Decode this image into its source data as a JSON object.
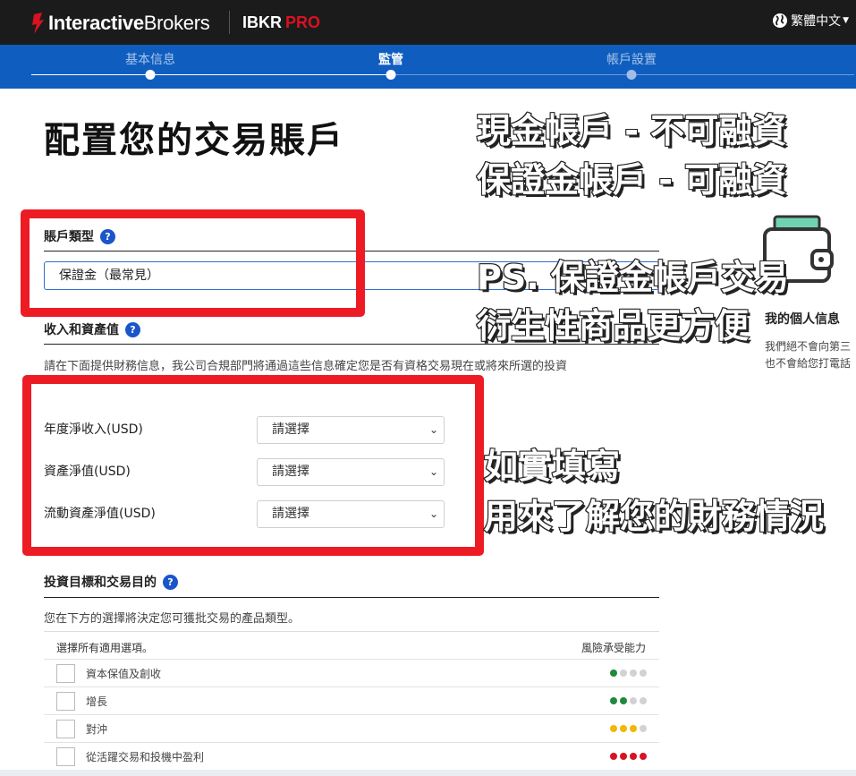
{
  "header": {
    "brand_bold": "Interactive",
    "brand_rest": "Brokers",
    "product_main": "IBKR",
    "product_accent": "PRO",
    "language": "繁體中文",
    "globe_icon": "globe-icon",
    "brand_red": "#d81222"
  },
  "stepper": {
    "steps": [
      {
        "label": "基本信息"
      },
      {
        "label": "監管"
      },
      {
        "label": "帳戶設置"
      }
    ],
    "active_index": 1,
    "color": "#0f5ebf"
  },
  "page": {
    "title": "配置您的交易賬戶"
  },
  "account_type": {
    "label": "賬戶類型",
    "help": "?",
    "value": "保證金（最常見）"
  },
  "income": {
    "label": "收入和資產值",
    "help": "?",
    "description": "請在下面提供財務信息，我公司合規部門將通過這些信息確定您是否有資格交易現在或將來所選的投資",
    "fields": [
      {
        "label": "年度淨收入(USD)",
        "value": "請選擇"
      },
      {
        "label": "資產淨值(USD)",
        "value": "請選擇"
      },
      {
        "label": "流動資產淨值(USD)",
        "value": "請選擇"
      }
    ]
  },
  "objectives": {
    "label": "投資目標和交易目的",
    "help": "?",
    "description": "您在下方的選擇將決定您可獲批交易的產品類型。",
    "header_left": "選擇所有適用選項。",
    "header_right": "風險承受能力",
    "options": [
      {
        "label": "資本保值及創收",
        "risk": 1,
        "color": "#1e8a3c"
      },
      {
        "label": "增長",
        "risk": 2,
        "color": "#1e8a3c"
      },
      {
        "label": "對沖",
        "risk": 3,
        "color": "#f2b705"
      },
      {
        "label": "從活躍交易和投機中盈利",
        "risk": 4,
        "color": "#d81222"
      }
    ]
  },
  "side": {
    "title": "我的個人信息",
    "line1": "我們絕不會向第三",
    "line2": "也不會給您打電話",
    "icon": "wallet-icon"
  },
  "captions": {
    "line1": "現金帳戶 - 不可融資",
    "line2": "保證金帳戶 - 可融資",
    "line3": "PS. 保證金帳戶交易",
    "line4": "衍生性商品更方便",
    "line5": "如實填寫",
    "line6": "用來了解您的財務情況"
  }
}
